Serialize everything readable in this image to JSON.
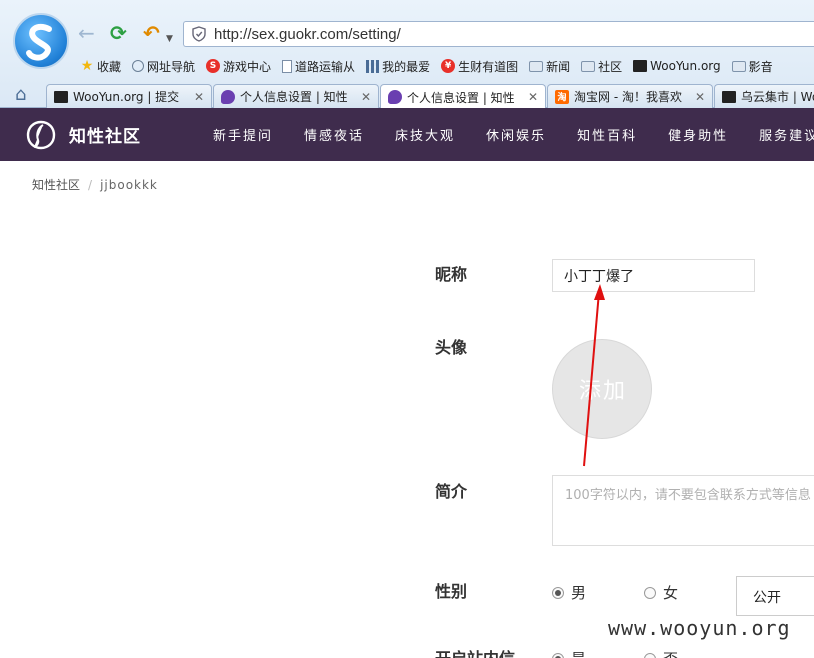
{
  "browser": {
    "url": "http://sex.guokr.com/setting/",
    "bookmarks": [
      {
        "label": "收藏",
        "icon": "star-icon"
      },
      {
        "label": "网址导航",
        "icon": "globe-icon"
      },
      {
        "label": "游戏中心",
        "icon": "game-icon"
      },
      {
        "label": "道路运输从",
        "icon": "page-icon"
      },
      {
        "label": "我的最爱",
        "icon": "grid-icon"
      },
      {
        "label": "生财有道图",
        "icon": "money-icon"
      },
      {
        "label": "新闻",
        "icon": "folder-icon"
      },
      {
        "label": "社区",
        "icon": "folder-icon"
      },
      {
        "label": "WooYun.org",
        "icon": "wooyun-icon"
      },
      {
        "label": "影音",
        "icon": "folder-icon"
      }
    ],
    "tabs": [
      {
        "label": "WooYun.org | 提交",
        "icon": "wooyun-icon"
      },
      {
        "label": "个人信息设置 | 知性",
        "icon": "guokr-icon"
      },
      {
        "label": "个人信息设置 | 知性",
        "icon": "guokr-icon",
        "active": true
      },
      {
        "label": "淘宝网 - 淘！我喜欢",
        "icon": "taobao-icon"
      },
      {
        "label": "乌云集市 | Wo",
        "icon": "wooyun-icon"
      }
    ]
  },
  "site": {
    "name": "知性社区",
    "nav": [
      "新手提问",
      "情感夜话",
      "床技大观",
      "休闲娱乐",
      "知性百科",
      "健身助性",
      "服务建议"
    ],
    "brand_color": "#3f2c4d"
  },
  "breadcrumb": {
    "home": "知性社区",
    "separator": "/",
    "current": "jjbookkk"
  },
  "form": {
    "nickname_label": "昵称",
    "nickname_value": "小丁丁爆了",
    "avatar_label": "头像",
    "avatar_add": "添加",
    "bio_label": "简介",
    "bio_placeholder": "100字符以内，请不要包含联系方式等信息",
    "gender_label": "性别",
    "gender_options": [
      "男",
      "女"
    ],
    "gender_selected": "男",
    "visibility_value": "公开",
    "dm_label": "开启站内信",
    "dm_options": [
      "是",
      "否"
    ]
  },
  "annotation": {
    "arrow_color": "#e01010"
  },
  "watermark": "www.wooyun.org"
}
